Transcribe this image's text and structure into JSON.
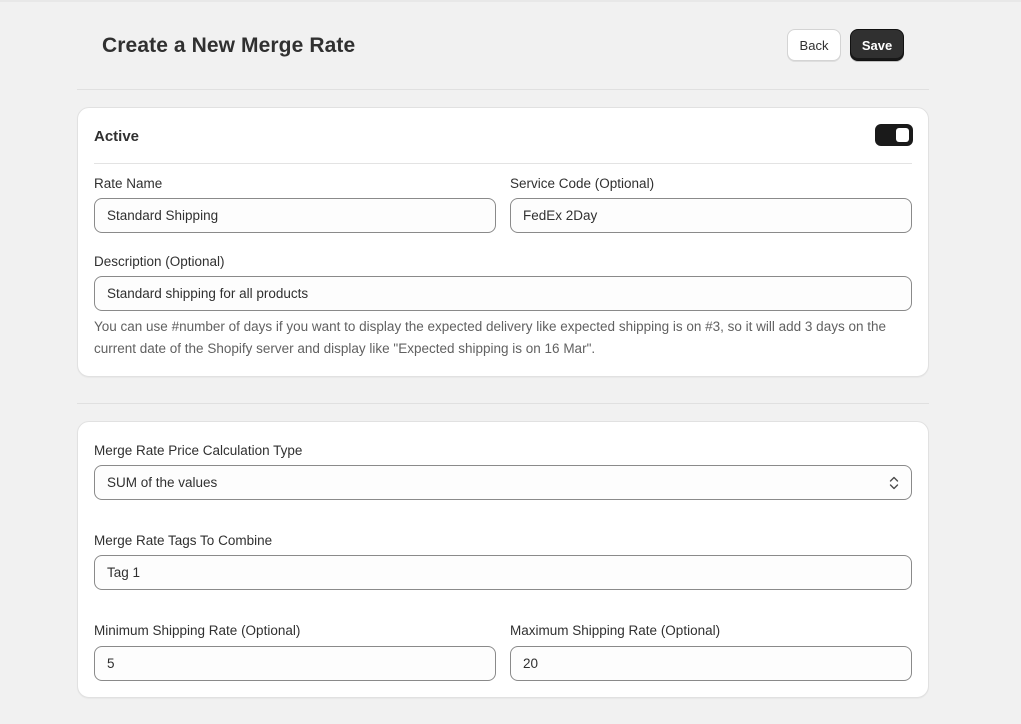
{
  "header": {
    "title": "Create a New Merge Rate",
    "back_label": "Back",
    "save_label": "Save"
  },
  "status_card": {
    "title": "Active",
    "toggle_on": true
  },
  "rate_form": {
    "rate_name": {
      "label": "Rate Name",
      "value": "Standard Shipping"
    },
    "service_code": {
      "label": "Service Code (Optional)",
      "value": "FedEx 2Day"
    },
    "description": {
      "label": "Description (Optional)",
      "value": "Standard shipping for all products"
    },
    "help_text": "You can use #number of days if you want to display the expected delivery like expected shipping is on #3, so it will add 3 days on the current date of the Shopify server and display like \"Expected shipping is on 16 Mar\"."
  },
  "merge_form": {
    "calc_type": {
      "label": "Merge Rate Price Calculation Type",
      "value": "SUM of the values"
    },
    "tags": {
      "label": "Merge Rate Tags To Combine",
      "value": "Tag 1"
    },
    "min_rate": {
      "label": "Minimum Shipping Rate (Optional)",
      "value": "5"
    },
    "max_rate": {
      "label": "Maximum Shipping Rate (Optional)",
      "value": "20"
    }
  },
  "colors": {
    "background": "#f1f1f1",
    "primary_button": "#303030",
    "toggle_on": "#1a1a1a"
  }
}
